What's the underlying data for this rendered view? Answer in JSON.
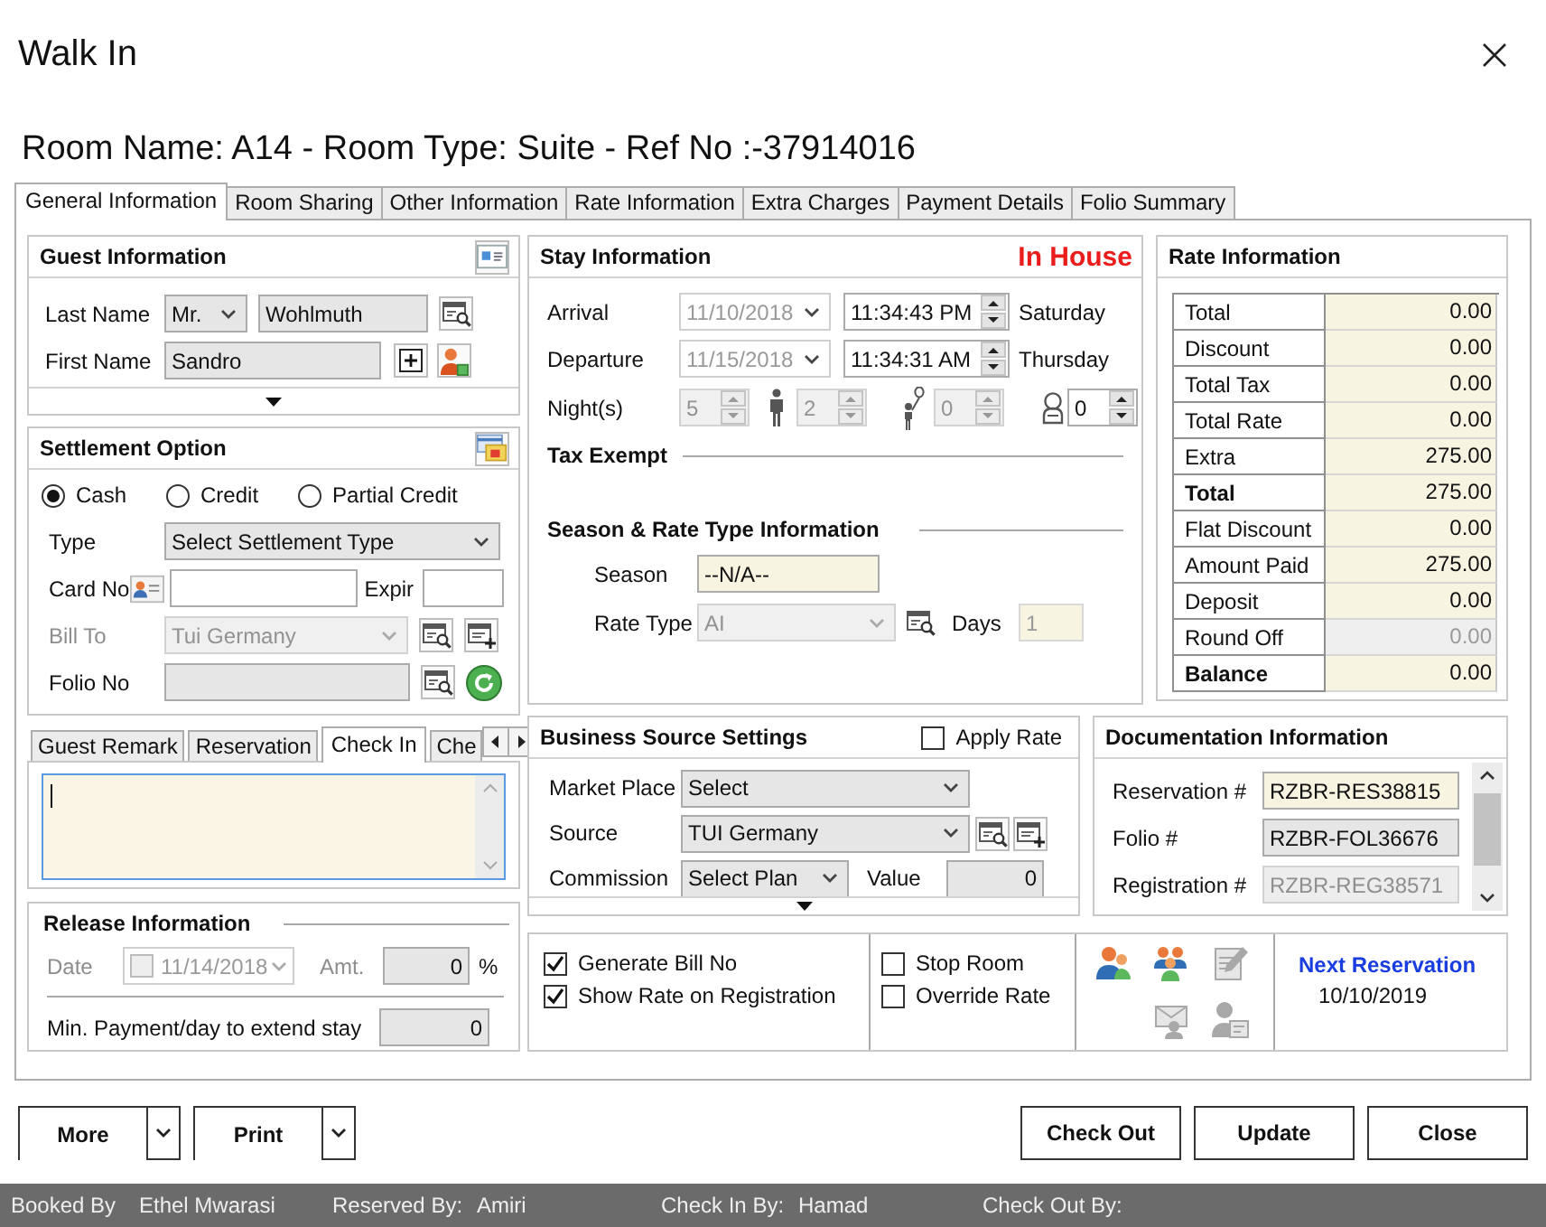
{
  "window": {
    "title": "Walk In"
  },
  "heading": "Room Name: A14 - Room Type: Suite - Ref No :-37914016",
  "tabs": [
    {
      "label": "General Information",
      "selected": true
    },
    {
      "label": "Room Sharing",
      "selected": false
    },
    {
      "label": "Other Information",
      "selected": false
    },
    {
      "label": "Rate Information",
      "selected": false
    },
    {
      "label": "Extra Charges",
      "selected": false
    },
    {
      "label": "Payment Details",
      "selected": false
    },
    {
      "label": "Folio Summary",
      "selected": false
    }
  ],
  "guest_information": {
    "title": "Guest Information",
    "last_name_label": "Last Name",
    "salutation": "Mr.",
    "last_name": "Wohlmuth",
    "first_name_label": "First Name",
    "first_name": "Sandro"
  },
  "settlement_option": {
    "title": "Settlement Option",
    "modes": [
      {
        "label": "Cash",
        "selected": true
      },
      {
        "label": "Credit",
        "selected": false
      },
      {
        "label": "Partial Credit",
        "selected": false
      }
    ],
    "type_label": "Type",
    "type": "Select Settlement Type",
    "card_label": "Card No",
    "expiry_label": "Expir",
    "bill_to_label": "Bill To",
    "bill_to": "Tui Germany",
    "bill_to_disabled": true,
    "folio_label": "Folio No"
  },
  "remark_tabs": [
    {
      "label": "Guest Remark",
      "selected": false
    },
    {
      "label": "Reservation",
      "selected": false
    },
    {
      "label": "Check In",
      "selected": true
    },
    {
      "label": "Che",
      "selected": false
    }
  ],
  "release_information": {
    "title": "Release Information",
    "disabled": true,
    "date_label": "Date",
    "date_checked": false,
    "date": "11/14/2018",
    "amount_label": "Amt.",
    "amount": "0",
    "amount_unit": "%",
    "min_payment_label": "Min. Payment/day to extend stay",
    "min_payment": "0"
  },
  "stay_information": {
    "title": "Stay Information",
    "status": "In House",
    "dates": [
      {
        "label": "Arrival",
        "date": "11/10/2018",
        "time": "11:34:43 PM",
        "day": "Saturday"
      },
      {
        "label": "Departure",
        "date": "11/15/2018",
        "time": "11:34:31 AM",
        "day": "Thursday"
      }
    ],
    "nights_label": "Night(s)",
    "counts": [
      {
        "kind": "nights",
        "value": "5",
        "disabled": true
      },
      {
        "kind": "adults",
        "value": "2",
        "disabled": true
      },
      {
        "kind": "children",
        "value": "0",
        "disabled": true
      },
      {
        "kind": "infants",
        "value": "0",
        "disabled": false
      }
    ],
    "tax_exempt": "Tax Exempt",
    "season_section": "Season & Rate Type Information",
    "season_label": "Season",
    "season": "--N/A--",
    "rate_type_label": "Rate Type",
    "rate_type": "AI",
    "days_label": "Days",
    "days": "1"
  },
  "rate_information": {
    "title": "Rate Information",
    "rows": [
      {
        "label": "Total",
        "value": "0.00",
        "strong": false,
        "disabled": false
      },
      {
        "label": "Discount",
        "value": "0.00",
        "strong": false,
        "disabled": false
      },
      {
        "label": "Total Tax",
        "value": "0.00",
        "strong": false,
        "disabled": false
      },
      {
        "label": "Total Rate",
        "value": "0.00",
        "strong": false,
        "disabled": false
      },
      {
        "label": "Extra",
        "value": "275.00",
        "strong": false,
        "disabled": false
      },
      {
        "label": "Total",
        "value": "275.00",
        "strong": true,
        "disabled": false
      },
      {
        "label": "Flat Discount",
        "value": "0.00",
        "strong": false,
        "disabled": false
      },
      {
        "label": "Amount Paid",
        "value": "275.00",
        "strong": false,
        "disabled": false
      },
      {
        "label": "Deposit",
        "value": "0.00",
        "strong": false,
        "disabled": false
      },
      {
        "label": "Round Off",
        "value": "0.00",
        "strong": false,
        "disabled": true
      },
      {
        "label": "Balance",
        "value": "0.00",
        "strong": true,
        "disabled": false
      }
    ]
  },
  "business_source": {
    "title": "Business Source Settings",
    "apply_rate_label": "Apply Rate",
    "apply_rate": false,
    "market_place_label": "Market Place",
    "market_place": "Select",
    "source_label": "Source",
    "source": "TUI Germany",
    "commission_label": "Commission",
    "commission": "Select Plan",
    "value_label": "Value",
    "value": "0"
  },
  "documentation": {
    "title": "Documentation Information",
    "rows": [
      {
        "label": "Reservation #",
        "value": "RZBR-RES38815",
        "kind": "highlight"
      },
      {
        "label": "Folio #",
        "value": "RZBR-FOL36676",
        "kind": "readonly"
      },
      {
        "label": "Registration #",
        "value": "RZBR-REG38571",
        "kind": "disabled"
      }
    ]
  },
  "bill_options": [
    {
      "label": "Generate Bill No",
      "checked": true
    },
    {
      "label": "Show Rate on Registration",
      "checked": true
    }
  ],
  "room_options": [
    {
      "label": "Stop Room",
      "checked": false
    },
    {
      "label": "Override Rate",
      "checked": false
    }
  ],
  "shortcuts": [
    {
      "kind": "person",
      "disabled": false
    },
    {
      "kind": "group",
      "disabled": false
    },
    {
      "kind": "signature",
      "disabled": true
    },
    {
      "kind": "visitor",
      "disabled": true
    },
    {
      "kind": "profile",
      "disabled": true
    }
  ],
  "next_reservation": {
    "label": "Next Reservation",
    "date": "10/10/2019"
  },
  "left_buttons": [
    {
      "label": "More",
      "dropdown": true
    },
    {
      "label": "Print",
      "dropdown": true
    }
  ],
  "right_buttons": [
    {
      "label": "Check Out",
      "dropdown": false
    },
    {
      "label": "Update",
      "dropdown": false
    },
    {
      "label": "Close",
      "dropdown": false
    }
  ],
  "status_bar": [
    {
      "label": "Booked By",
      "value": "Ethel Mwarasi"
    },
    {
      "label": "Reserved By:",
      "value": "Amiri"
    },
    {
      "label": "Check In By:",
      "value": "Hamad"
    },
    {
      "label": "Check Out By:"
    }
  ]
}
